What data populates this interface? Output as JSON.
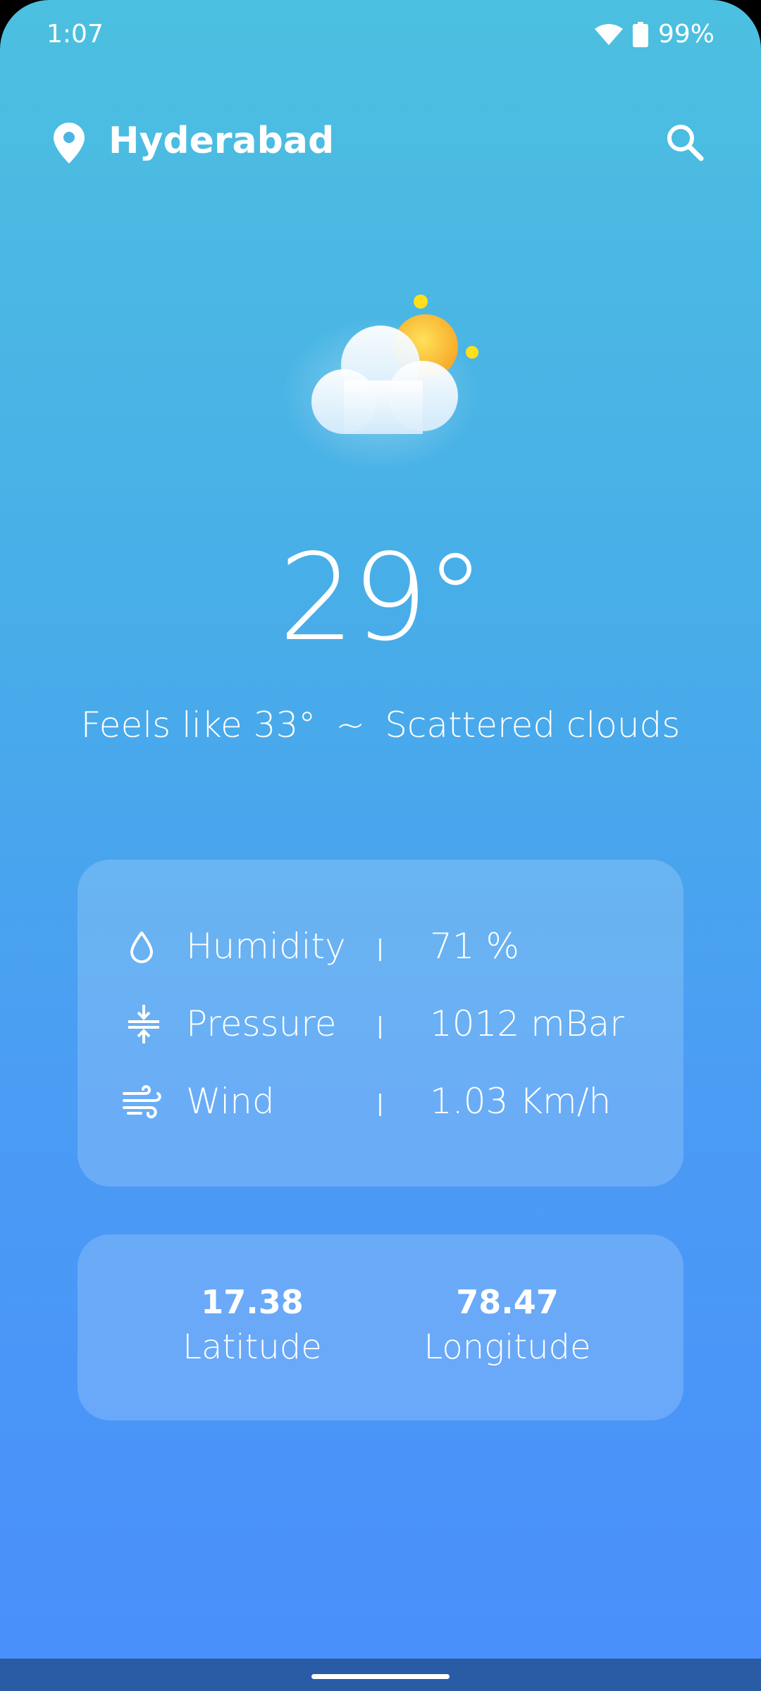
{
  "status_bar": {
    "time": "1:07",
    "battery": "99%"
  },
  "header": {
    "city": "Hyderabad"
  },
  "weather": {
    "condition_icon": "partly-cloudy-icon",
    "temperature": "29°",
    "feels_like": "Feels like 33°",
    "separator": "~",
    "description": "Scattered clouds"
  },
  "details": [
    {
      "icon": "droplet-icon",
      "label": "Humidity",
      "value": "71 %"
    },
    {
      "icon": "pressure-icon",
      "label": "Pressure",
      "value": "1012 mBar"
    },
    {
      "icon": "wind-icon",
      "label": "Wind",
      "value": "1.03 Km/h"
    }
  ],
  "coordinates": {
    "latitude_value": "17.38",
    "latitude_label": "Latitude",
    "longitude_value": "78.47",
    "longitude_label": "Longitude"
  },
  "colors": {
    "background_top": "#4cc0e0",
    "background_bottom": "#4a8ffc",
    "sun": "#fbbf24"
  }
}
